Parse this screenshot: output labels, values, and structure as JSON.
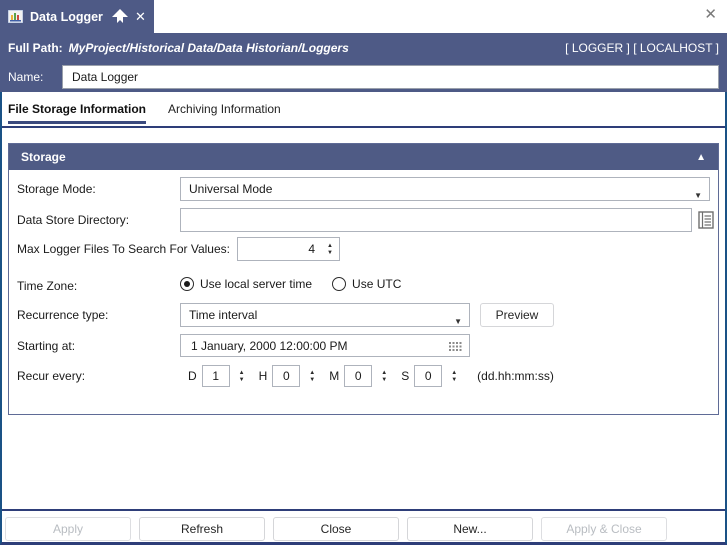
{
  "window": {
    "close_icon_name": "window-close"
  },
  "tab": {
    "title": "Data Logger"
  },
  "fullpath": {
    "label": "Full Path:",
    "path": "MyProject/Historical Data/Data Historian/Loggers",
    "badges": "[ LOGGER ] [ LOCALHOST ]"
  },
  "name_field": {
    "label": "Name:",
    "value": "Data Logger"
  },
  "tabs": {
    "file_storage": "File Storage Information",
    "archiving": "Archiving Information"
  },
  "storage": {
    "header": "Storage",
    "storage_mode": {
      "label": "Storage Mode:",
      "value": "Universal Mode"
    },
    "data_store_directory": {
      "label": "Data Store Directory:",
      "value": ""
    },
    "max_logger_files": {
      "label": "Max Logger Files To Search For Values:",
      "value": "4"
    },
    "time_zone": {
      "label": "Time Zone:",
      "local_option": "Use local server time",
      "utc_option": "Use UTC",
      "selected": "local"
    },
    "recurrence": {
      "label": "Recurrence type:",
      "value": "Time interval",
      "preview_label": "Preview"
    },
    "starting_at": {
      "label": "Starting at:",
      "value": "1 January, 2000 12:00:00 PM"
    },
    "recur_every": {
      "label": "Recur every:",
      "d_label": "D",
      "d_value": "1",
      "h_label": "H",
      "h_value": "0",
      "m_label": "M",
      "m_value": "0",
      "s_label": "S",
      "s_value": "0",
      "format_hint": "(dd.hh:mm:ss)"
    }
  },
  "buttons": {
    "apply": "Apply",
    "refresh": "Refresh",
    "close": "Close",
    "new": "New...",
    "apply_close": "Apply & Close"
  },
  "colors": {
    "header_bg": "#4e5a86",
    "group_header_bg": "#4f5b85",
    "active_tab_underline": "#3b4a7e",
    "separator": "#2e3e79",
    "frame": "#1a5286"
  }
}
